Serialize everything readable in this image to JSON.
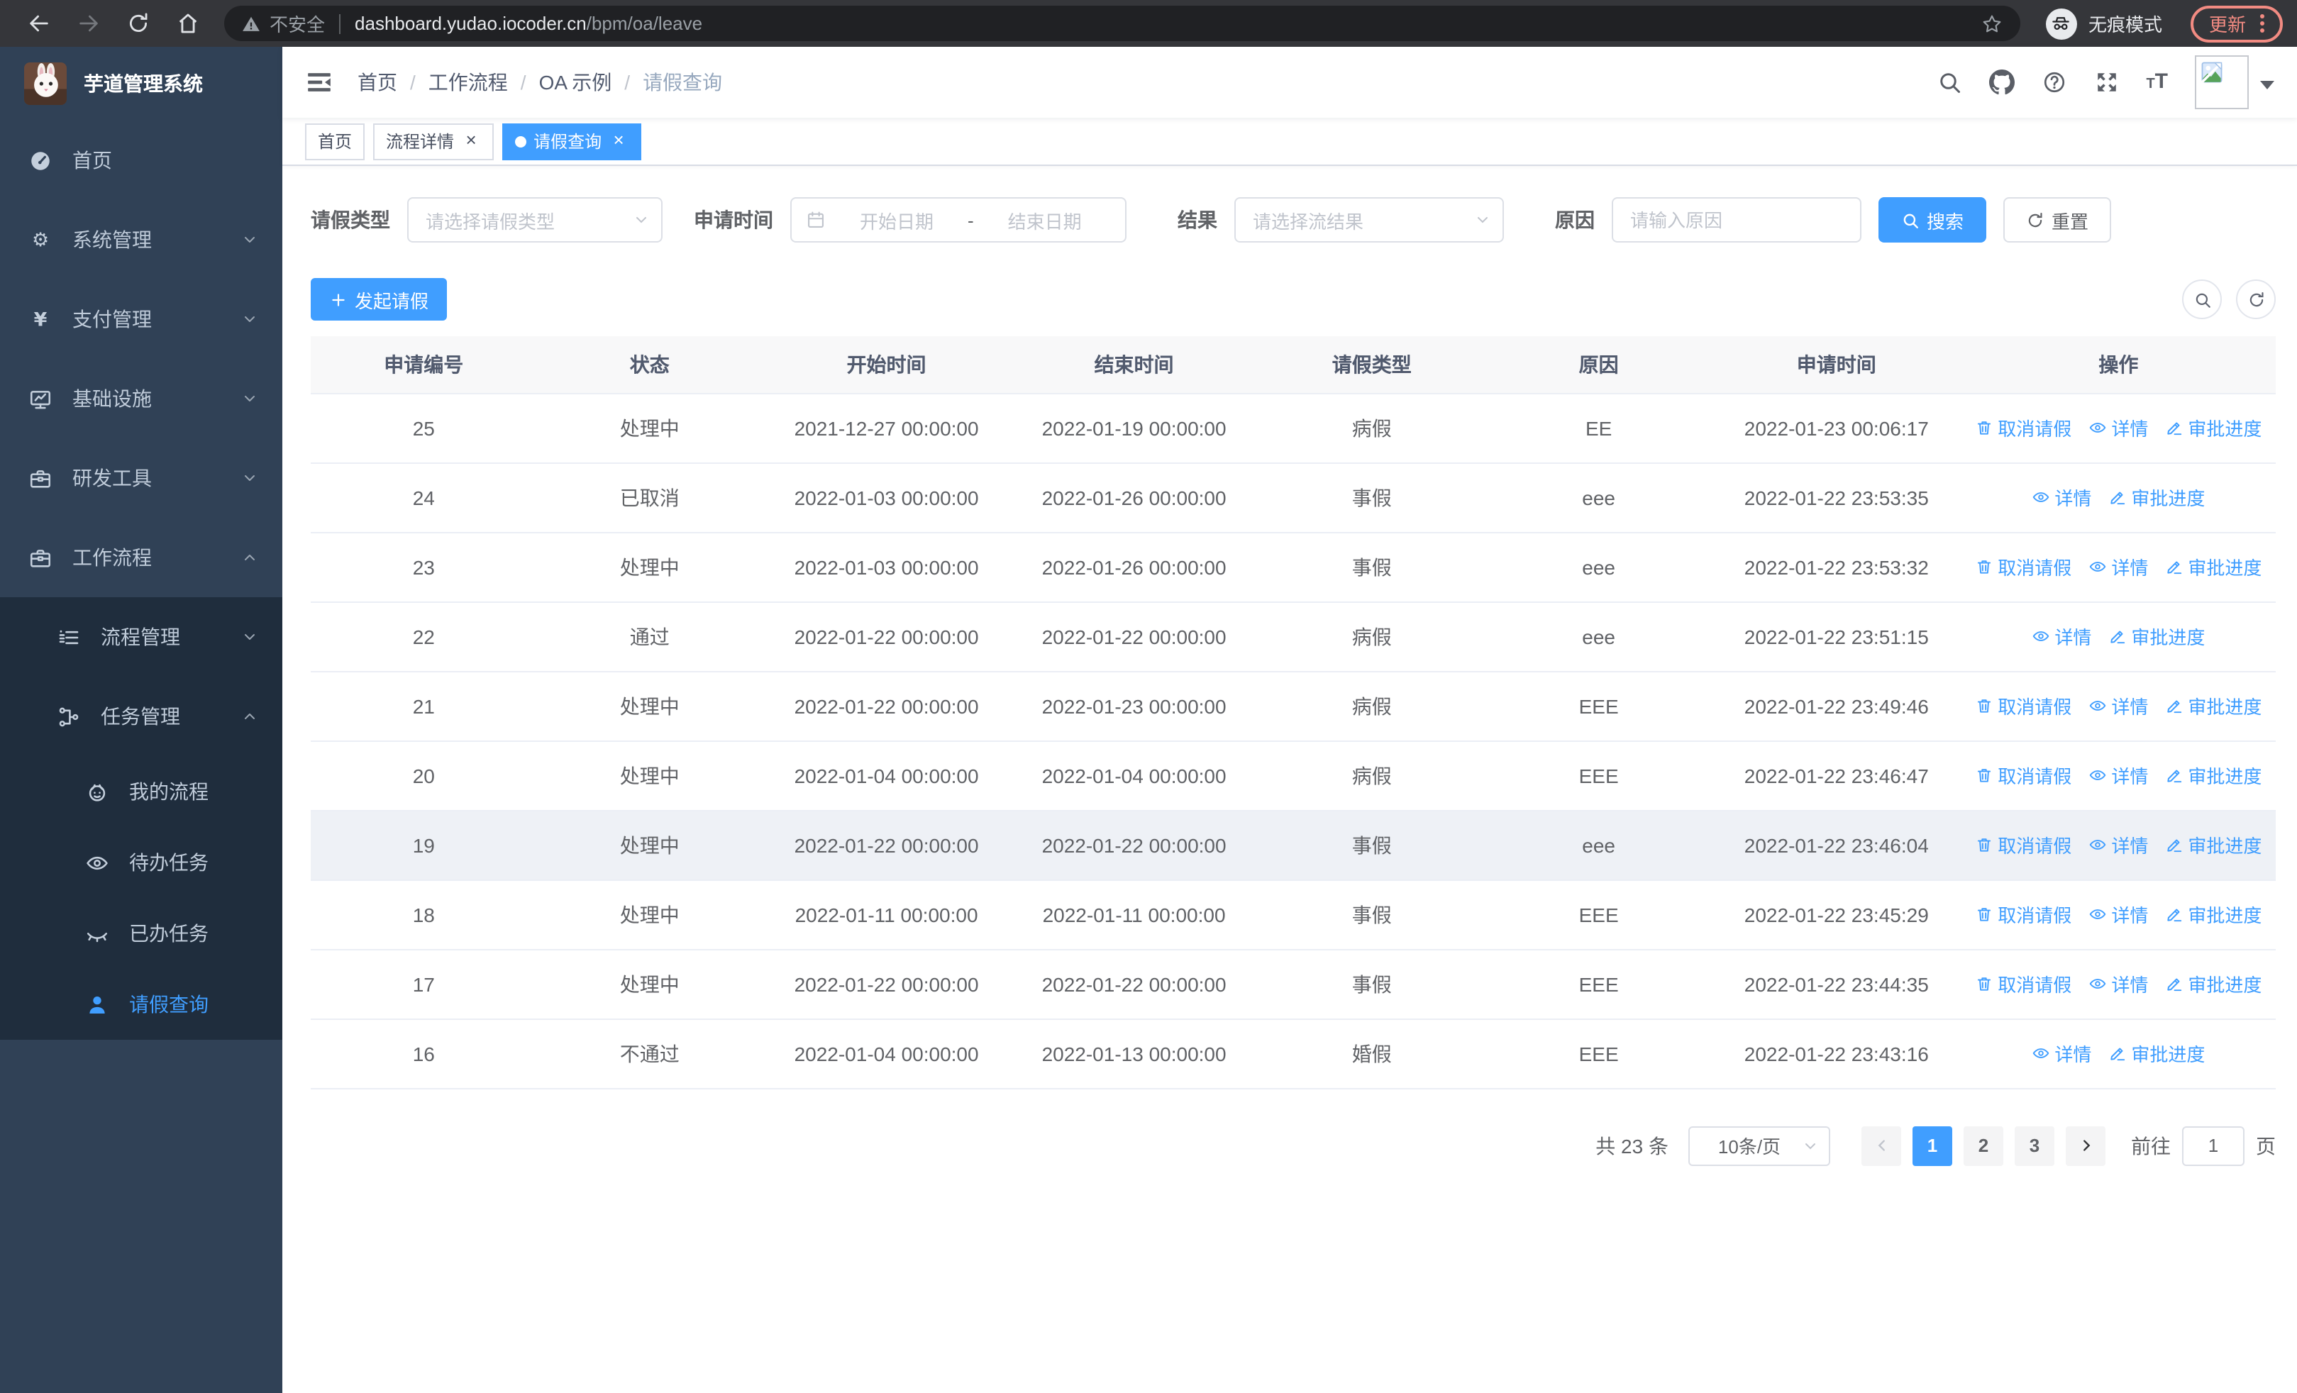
{
  "colors": {
    "primary": "#409eff",
    "sidebar_bg": "#304156",
    "submenu_bg": "#1f2d3d",
    "update_accent": "#f28b82"
  },
  "browser": {
    "security_warning": "不安全",
    "url_host": "dashboard.yudao.iocoder.cn",
    "url_path": "/bpm/oa/leave",
    "incognito_label": "无痕模式",
    "update_label": "更新"
  },
  "sidebar": {
    "app_title": "芋道管理系统",
    "menu": [
      {
        "key": "home",
        "label": "首页",
        "icon": "dashboard-icon",
        "level": 1
      },
      {
        "key": "system",
        "label": "系统管理",
        "icon": "gear-icon",
        "level": 1,
        "chevron": "down"
      },
      {
        "key": "payment",
        "label": "支付管理",
        "icon": "yen-icon",
        "level": 1,
        "chevron": "down"
      },
      {
        "key": "infrastructure",
        "label": "基础设施",
        "icon": "monitor-icon",
        "level": 1,
        "chevron": "down"
      },
      {
        "key": "devtools",
        "label": "研发工具",
        "icon": "toolbox-icon",
        "level": 1,
        "chevron": "down"
      },
      {
        "key": "workflow",
        "label": "工作流程",
        "icon": "briefcase-icon",
        "level": 1,
        "chevron": "up",
        "children": [
          {
            "key": "process-mgmt",
            "label": "流程管理",
            "icon": "flow-list-icon",
            "level": 2,
            "chevron": "down"
          },
          {
            "key": "task-mgmt",
            "label": "任务管理",
            "icon": "org-tree-icon",
            "level": 2,
            "chevron": "up",
            "children": [
              {
                "key": "my-process",
                "label": "我的流程",
                "icon": "face-icon",
                "level": 3
              },
              {
                "key": "todo-tasks",
                "label": "待办任务",
                "icon": "eye-icon",
                "level": 3
              },
              {
                "key": "done-tasks",
                "label": "已办任务",
                "icon": "eye-closed-icon",
                "level": 3
              },
              {
                "key": "leave-query",
                "label": "请假查询",
                "icon": "user-icon",
                "level": 3,
                "active": true
              }
            ]
          }
        ]
      }
    ]
  },
  "navbar": {
    "breadcrumb": [
      "首页",
      "工作流程",
      "OA 示例",
      "请假查询"
    ]
  },
  "tags": [
    {
      "label": "首页",
      "closable": false,
      "active": false
    },
    {
      "label": "流程详情",
      "closable": true,
      "active": false
    },
    {
      "label": "请假查询",
      "closable": true,
      "active": true
    }
  ],
  "filters": {
    "leave_type_label": "请假类型",
    "leave_type_placeholder": "请选择请假类型",
    "apply_time_label": "申请时间",
    "start_date_placeholder": "开始日期",
    "range_separator": "-",
    "end_date_placeholder": "结束日期",
    "result_label": "结果",
    "result_placeholder": "请选择流结果",
    "reason_label": "原因",
    "reason_placeholder": "请输入原因",
    "search_label": "搜索",
    "reset_label": "重置"
  },
  "toolbar": {
    "create_label": "发起请假"
  },
  "table": {
    "columns": [
      "申请编号",
      "状态",
      "开始时间",
      "结束时间",
      "请假类型",
      "原因",
      "申请时间",
      "操作"
    ],
    "action_labels": {
      "cancel": "取消请假",
      "detail": "详情",
      "progress": "审批进度"
    },
    "rows": [
      {
        "id": "25",
        "status": "处理中",
        "start": "2021-12-27 00:00:00",
        "end": "2022-01-19 00:00:00",
        "type": "病假",
        "reason": "EE",
        "applied": "2022-01-23 00:06:17",
        "actions": [
          "cancel",
          "detail",
          "progress"
        ]
      },
      {
        "id": "24",
        "status": "已取消",
        "start": "2022-01-03 00:00:00",
        "end": "2022-01-26 00:00:00",
        "type": "事假",
        "reason": "eee",
        "applied": "2022-01-22 23:53:35",
        "actions": [
          "detail",
          "progress"
        ]
      },
      {
        "id": "23",
        "status": "处理中",
        "start": "2022-01-03 00:00:00",
        "end": "2022-01-26 00:00:00",
        "type": "事假",
        "reason": "eee",
        "applied": "2022-01-22 23:53:32",
        "actions": [
          "cancel",
          "detail",
          "progress"
        ]
      },
      {
        "id": "22",
        "status": "通过",
        "start": "2022-01-22 00:00:00",
        "end": "2022-01-22 00:00:00",
        "type": "病假",
        "reason": "eee",
        "applied": "2022-01-22 23:51:15",
        "actions": [
          "detail",
          "progress"
        ]
      },
      {
        "id": "21",
        "status": "处理中",
        "start": "2022-01-22 00:00:00",
        "end": "2022-01-23 00:00:00",
        "type": "病假",
        "reason": "EEE",
        "applied": "2022-01-22 23:49:46",
        "actions": [
          "cancel",
          "detail",
          "progress"
        ]
      },
      {
        "id": "20",
        "status": "处理中",
        "start": "2022-01-04 00:00:00",
        "end": "2022-01-04 00:00:00",
        "type": "病假",
        "reason": "EEE",
        "applied": "2022-01-22 23:46:47",
        "actions": [
          "cancel",
          "detail",
          "progress"
        ]
      },
      {
        "id": "19",
        "status": "处理中",
        "start": "2022-01-22 00:00:00",
        "end": "2022-01-22 00:00:00",
        "type": "事假",
        "reason": "eee",
        "applied": "2022-01-22 23:46:04",
        "actions": [
          "cancel",
          "detail",
          "progress"
        ],
        "highlighted": true
      },
      {
        "id": "18",
        "status": "处理中",
        "start": "2022-01-11 00:00:00",
        "end": "2022-01-11 00:00:00",
        "type": "事假",
        "reason": "EEE",
        "applied": "2022-01-22 23:45:29",
        "actions": [
          "cancel",
          "detail",
          "progress"
        ]
      },
      {
        "id": "17",
        "status": "处理中",
        "start": "2022-01-22 00:00:00",
        "end": "2022-01-22 00:00:00",
        "type": "事假",
        "reason": "EEE",
        "applied": "2022-01-22 23:44:35",
        "actions": [
          "cancel",
          "detail",
          "progress"
        ]
      },
      {
        "id": "16",
        "status": "不通过",
        "start": "2022-01-04 00:00:00",
        "end": "2022-01-13 00:00:00",
        "type": "婚假",
        "reason": "EEE",
        "applied": "2022-01-22 23:43:16",
        "actions": [
          "detail",
          "progress"
        ]
      }
    ]
  },
  "pagination": {
    "total_label": "共 23 条",
    "page_size_label": "10条/页",
    "pages": [
      "1",
      "2",
      "3"
    ],
    "active_page": "1",
    "goto_label": "前往",
    "goto_value": "1",
    "page_unit_label": "页"
  }
}
